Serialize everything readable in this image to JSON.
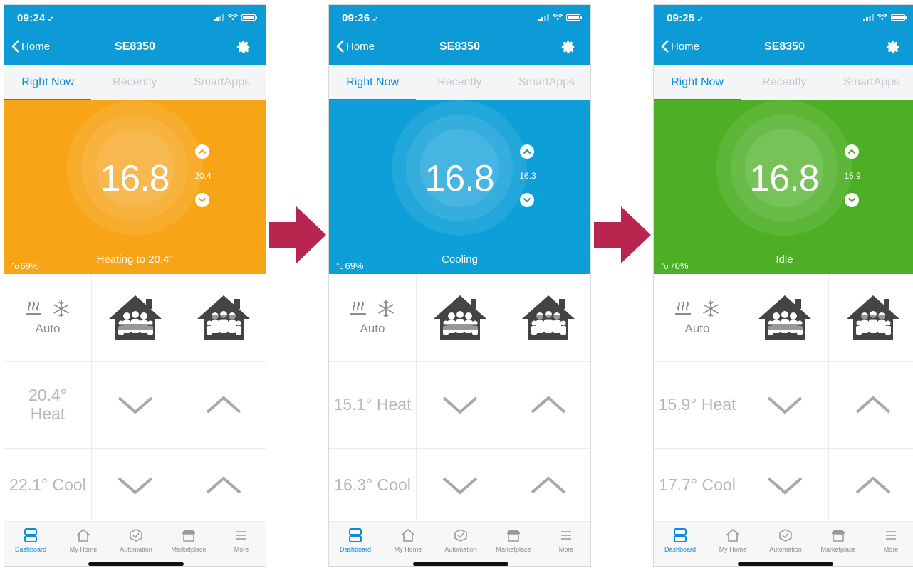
{
  "colors": {
    "header": "#0c9bd6",
    "accent": "#0c8ed6",
    "arrow": "#b8264f"
  },
  "screens": [
    {
      "status_time": "09:24",
      "nav": {
        "back_label": "Home",
        "title": "SE8350"
      },
      "tabs": [
        "Right Now",
        "Recently",
        "SmartApps"
      ],
      "hero_color": "#f7a417",
      "current_temp": "16.8",
      "setpoint": "20.4",
      "humidity": "69%",
      "operating_state": "Heating to 20.4°",
      "mode_label": "Auto",
      "heat_setpoint_text": "20.4° Heat",
      "cool_setpoint_text": "22.1° Cool",
      "occupancy_icon": "occupied-house-icon",
      "tabbar": [
        "Dashboard",
        "My Home",
        "Automation",
        "Marketplace",
        "More"
      ]
    },
    {
      "status_time": "09:26",
      "nav": {
        "back_label": "Home",
        "title": "SE8350"
      },
      "tabs": [
        "Right Now",
        "Recently",
        "SmartApps"
      ],
      "hero_color": "#0d9fd8",
      "current_temp": "16.8",
      "setpoint": "16.3",
      "humidity": "69%",
      "operating_state": "Cooling",
      "mode_label": "Auto",
      "heat_setpoint_text": "15.1° Heat",
      "cool_setpoint_text": "16.3° Cool",
      "occupancy_icon": "occupied-house-icon",
      "tabbar": [
        "Dashboard",
        "My Home",
        "Automation",
        "Marketplace",
        "More"
      ]
    },
    {
      "status_time": "09:25",
      "nav": {
        "back_label": "Home",
        "title": "SE8350"
      },
      "tabs": [
        "Right Now",
        "Recently",
        "SmartApps"
      ],
      "hero_color": "#4caf25",
      "current_temp": "16.8",
      "setpoint": "15.9",
      "humidity": "70%",
      "operating_state": "Idle",
      "mode_label": "Auto",
      "heat_setpoint_text": "15.9° Heat",
      "cool_setpoint_text": "17.7° Cool",
      "occupancy_icon": "occupied-house-icon",
      "tabbar": [
        "Dashboard",
        "My Home",
        "Automation",
        "Marketplace",
        "More"
      ]
    }
  ]
}
